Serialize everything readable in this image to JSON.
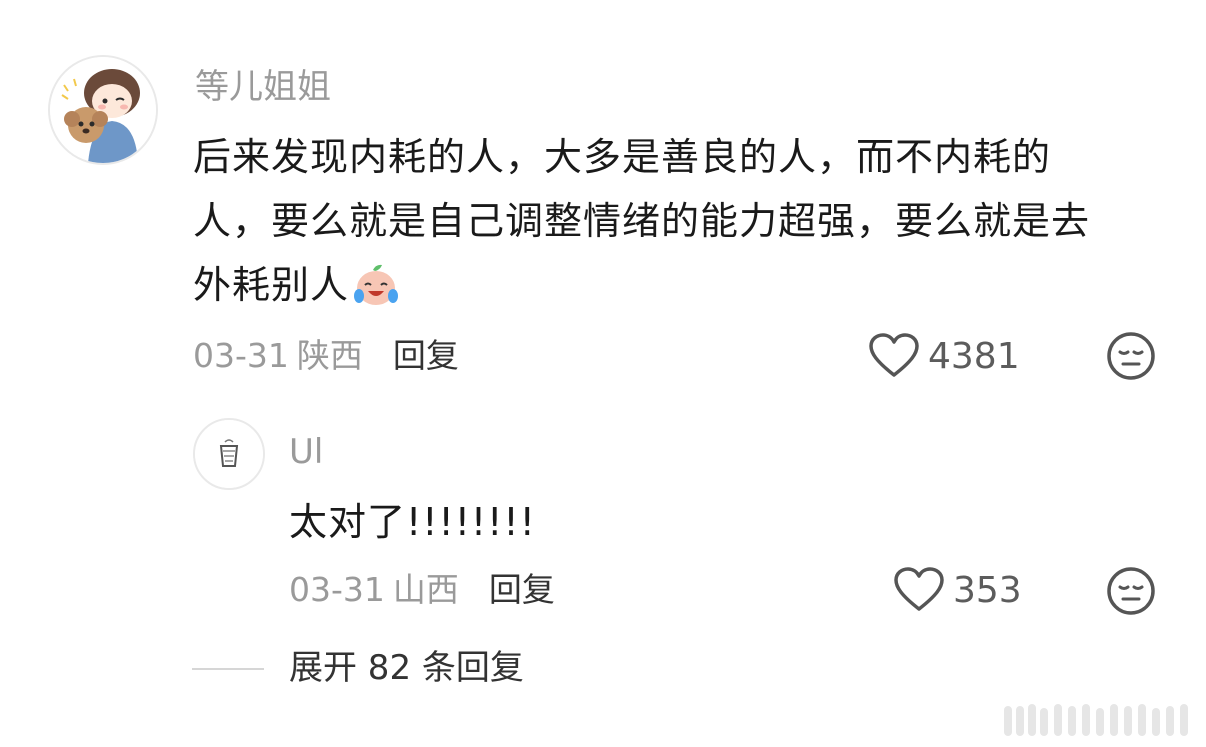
{
  "comment": {
    "username": "等儿姐姐",
    "lines": [
      "后来发现内耗的人，大多是善良的人，而不内耗的",
      "人，要么就是自己调整情绪的能力超强，要么就是去",
      "外耗别人"
    ],
    "emoji_icon": "crying-laughing-emoji-icon",
    "date": "03-31",
    "location": "陕西",
    "reply_label": "回复",
    "like_count": "4381"
  },
  "reply": {
    "username": "Ul",
    "text": "太对了!!!!!!!!",
    "date": "03-31",
    "location": "山西",
    "reply_label": "回复",
    "like_count": "353"
  },
  "expand_label": "展开 82 条回复",
  "colors": {
    "username": "#9a9a9a",
    "text": "#1a1a1a",
    "meta": "#9a9a9a",
    "reply_action": "#333333",
    "icon": "#555555"
  }
}
